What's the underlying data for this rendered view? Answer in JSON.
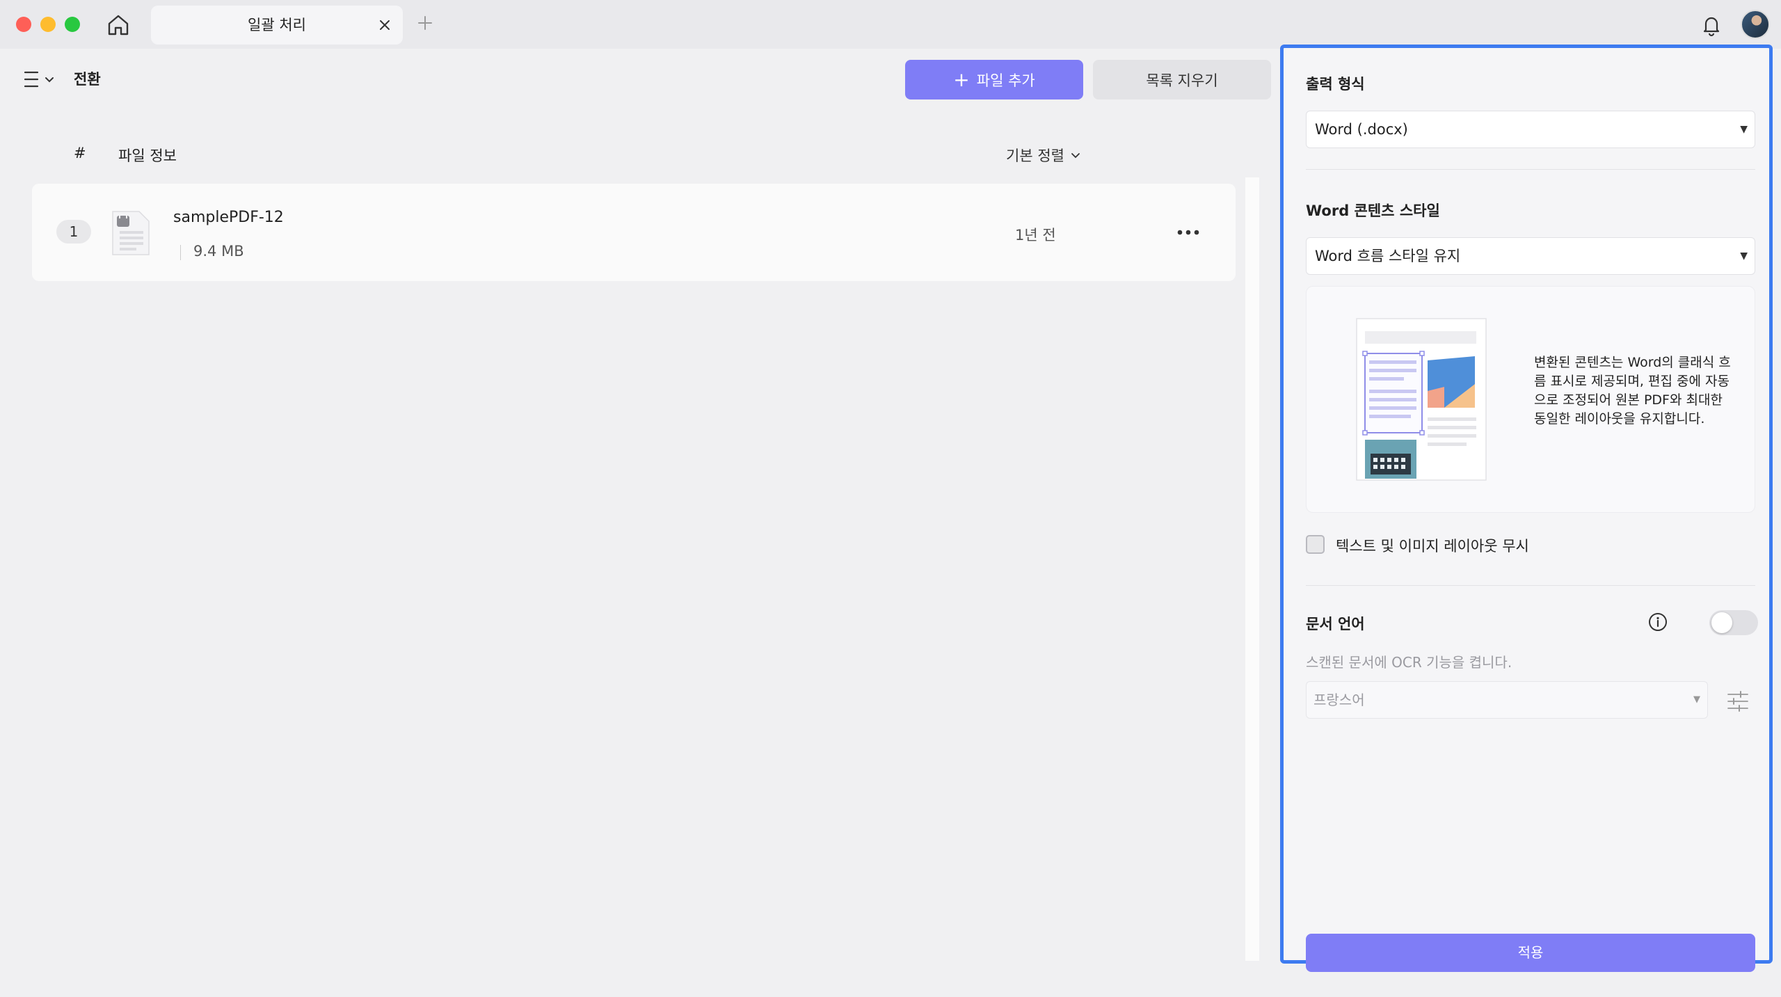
{
  "window": {
    "tab_title": "일괄 처리"
  },
  "left": {
    "section_title": "전환",
    "add_file_label": "파일 추가",
    "clear_list_label": "목록 지우기",
    "columns": {
      "number": "#",
      "file_info": "파일 정보"
    },
    "sort_label": "기본 정렬",
    "files": [
      {
        "index": "1",
        "name": "samplePDF-12",
        "size": "9.4 MB",
        "modified": "1년 전"
      }
    ]
  },
  "right": {
    "output_format_label": "출력 형식",
    "output_format_value": "Word (.docx)",
    "content_style_label": "Word 콘텐츠 스타일",
    "content_style_value": "Word 흐름 스타일 유지",
    "preview_description": "변환된 콘텐츠는 Word의 클래식 흐름 표시로 제공되며, 편집 중에 자동으로 조정되어 원본 PDF와 최대한 동일한 레이아웃을 유지합니다.",
    "ignore_layout_label": "텍스트 및 이미지 레이아웃 무시",
    "ignore_layout_checked": false,
    "doc_language_label": "문서 언어",
    "ocr_enabled": false,
    "ocr_description": "스캔된 문서에 OCR 기능을 켭니다.",
    "language_value": "프랑스어",
    "apply_label": "적용"
  },
  "colors": {
    "accent": "#7f7df6",
    "panel_border": "#3d7bf0",
    "traffic_red": "#fe5f57",
    "traffic_yellow": "#febc2e",
    "traffic_green": "#28c840"
  }
}
